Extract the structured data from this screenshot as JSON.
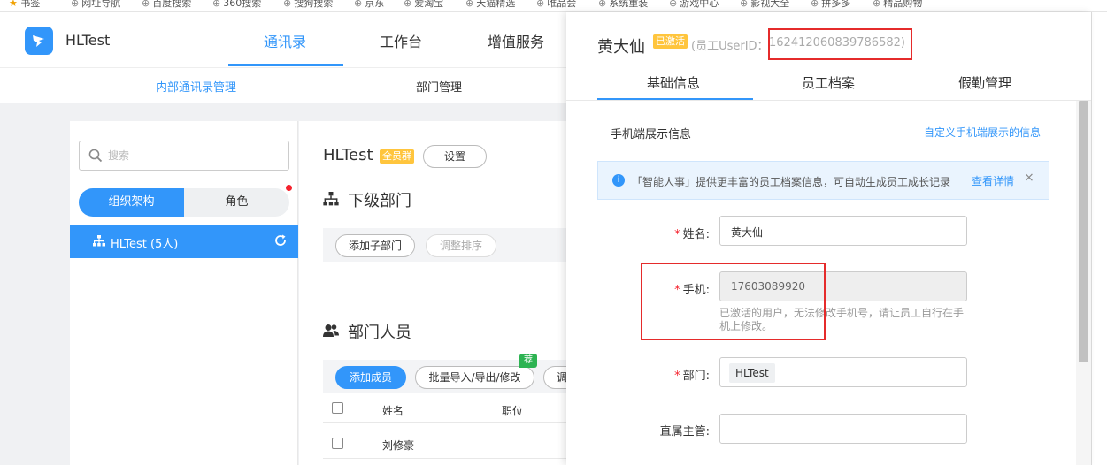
{
  "bookmarks": {
    "items": [
      {
        "label": "书签",
        "x_hint": "star"
      },
      {
        "label": "网址导航"
      },
      {
        "label": "百度搜索"
      },
      {
        "label": "360搜索"
      },
      {
        "label": "搜狗搜索"
      },
      {
        "label": "京东"
      },
      {
        "label": "爱淘宝"
      },
      {
        "label": "天猫精选"
      },
      {
        "label": "唯品会"
      },
      {
        "label": "系统重装"
      },
      {
        "label": "游戏中心"
      },
      {
        "label": "影视大全"
      },
      {
        "label": "拼多多"
      },
      {
        "label": "精品购物"
      }
    ]
  },
  "header": {
    "brand": "HLTest",
    "tabs": [
      "通讯录",
      "工作台",
      "增值服务"
    ],
    "active_tab": 0,
    "subtabs": [
      "内部通讯录管理",
      "部门管理"
    ]
  },
  "sidebar": {
    "search_placeholder": "搜索",
    "segments": [
      "组织架构",
      "角色"
    ],
    "tree_item": "HLTest (5人)"
  },
  "department": {
    "org_name": "HLTest",
    "org_tag": "全员群",
    "settings_button": "设置",
    "sub_section_title": "下级部门",
    "add_sub_button": "添加子部门",
    "reorder_button": "调整排序",
    "members_section_title": "部门人员",
    "add_member_button": "添加成员",
    "import_button": "批量导入/导出/修改",
    "more_button_partial": "调",
    "rec_badge": "荐",
    "table_headers": [
      "姓名",
      "职位"
    ],
    "rows": [
      {
        "name": "刘修豪",
        "title": ""
      }
    ]
  },
  "drawer": {
    "name": "黄大仙",
    "status": "已激活",
    "uid_label": "(员工UserID：",
    "uid_value": "162412060839786582)",
    "tabs": [
      "基础信息",
      "员工档案",
      "假勤管理"
    ],
    "active_tab": 0,
    "section_title": "手机端展示信息",
    "section_link": "自定义手机端展示的信息",
    "info_icon": "i",
    "info_text": "「智能人事」提供更丰富的员工档案信息，可自动生成员工成长记录",
    "info_link": "查看详情",
    "info_close": "×",
    "fields": {
      "name_label": "姓名:",
      "name_value": "黄大仙",
      "phone_label": "手机:",
      "phone_value": "17603089920",
      "phone_hint": "已激活的用户，无法修改手机号，请让员工自行在手机上修改。",
      "dept_label": "部门:",
      "dept_value": "HLTest",
      "manager_label": "直属主管:",
      "manager_value": ""
    }
  },
  "colors": {
    "accent": "#3296fa",
    "tag": "#ffc53d",
    "highlight_box": "#e52b2b",
    "recommend": "#2db352"
  }
}
